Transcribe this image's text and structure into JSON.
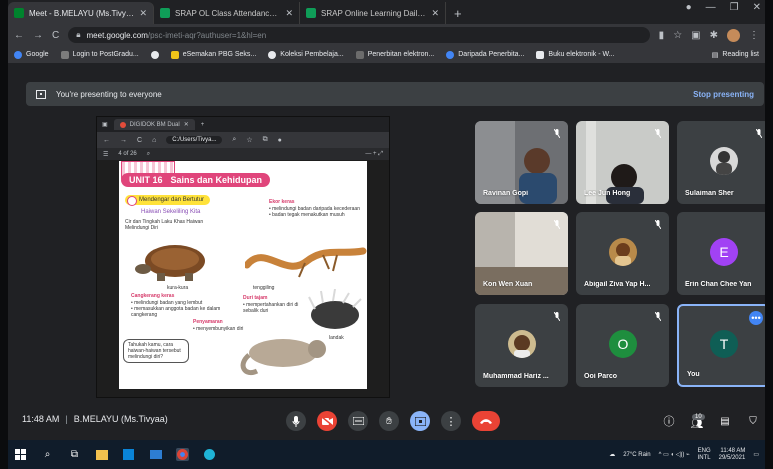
{
  "browser": {
    "tabs": [
      {
        "label": "Meet - B.MELAYU (Ms.Tivyaa)",
        "icon": "meet-icon",
        "active": true
      },
      {
        "label": "SRAP OL Class Attendance ( Mi",
        "icon": "sheets-icon",
        "active": false
      },
      {
        "label": "SRAP Online Learning Daily Rep",
        "icon": "sheets-icon",
        "active": false
      }
    ],
    "url_host": "meet.google.com",
    "url_path": "/psc-imeti-aqr?authuser=1&hl=en",
    "bookmarks": [
      {
        "label": "Google",
        "color": "#4285f4"
      },
      {
        "label": "Login to PostGradu...",
        "color": "#7c7c7c"
      },
      {
        "label": "",
        "color": "#e8eaed"
      },
      {
        "label": "eSemakan PBG Seks...",
        "color": "#f0c419"
      },
      {
        "label": "Koleksi Pembelaja...",
        "color": "#e8eaed"
      },
      {
        "label": "Penerbitan elektron...",
        "color": "#6c6c6c"
      },
      {
        "label": "Daripada Penerbita...",
        "color": "#4285f4"
      },
      {
        "label": "Buku elektronik - W...",
        "color": "#e8eaed"
      }
    ],
    "reading_list": "Reading list"
  },
  "meet": {
    "banner_text": "You're presenting to everyone",
    "stop_label": "Stop presenting",
    "time": "11:48 AM",
    "meeting_name": "B.MELAYU (Ms.Tivyaa)",
    "participant_count": "10",
    "participants": [
      {
        "name": "Ravinan Gopi",
        "kind": "video",
        "muted": true
      },
      {
        "name": "Lee Jun Hong",
        "kind": "video",
        "muted": true
      },
      {
        "name": "Sulaiman Sher",
        "kind": "photo",
        "muted": true
      },
      {
        "name": "Kon Wen Xuan",
        "kind": "video",
        "muted": true
      },
      {
        "name": "Abigail Ziva Yap H...",
        "kind": "photo",
        "muted": true
      },
      {
        "name": "Erin Chan Chee Yan",
        "kind": "letter",
        "letter": "E",
        "color": "#a142f4",
        "muted": false
      },
      {
        "name": "Muhammad Hariz ...",
        "kind": "photo",
        "muted": true
      },
      {
        "name": "Ooi Parco",
        "kind": "letter",
        "letter": "O",
        "color": "#1e8e3e",
        "muted": true
      },
      {
        "name": "You",
        "kind": "letter",
        "letter": "T",
        "color": "#0f5e55",
        "muted": false
      }
    ]
  },
  "presented": {
    "tab_label": "DIGIDOK BM Dual",
    "file_label": "C:/Users/Tivya...",
    "zoom": "4 of 26",
    "unit": "UNIT 16",
    "unit_title": "Sains dan Kehidupan",
    "subtitle": "Mendengar dan Bertutur",
    "topic": "Haiwan Sekeliling Kita",
    "intro": "Cir dan Tingkah Laku Khas Haiwan Melindungi Diri",
    "tortoise_label": "kura-kura",
    "tortoise_head": "Cangkerang keras",
    "tortoise_text": "• melindungi badan yang lembut\n• memasukkan anggota badan ke dalam cangkerang",
    "lizard_head": "Ekor keras",
    "lizard_text": "• melindungi badan daripada kecederaan\n• badan tegak menakutkan musuh",
    "lizard_label": "tenggiling",
    "porcupine_head": "Duri tajam",
    "porcupine_text": "• mempertahankan diri di sebalik duri",
    "porcupine_label": "landak",
    "chameleon_head": "Penyamaran",
    "chameleon_text": "• menyembunyikan diri",
    "callout": "Tahukah kamu, cara haiwan-haiwan tersebut melindungi diri?"
  },
  "taskbar": {
    "weather": "27°C Rain",
    "lang_top": "ENG",
    "lang_bottom": "INTL",
    "time": "11:48 AM",
    "date": "29/5/2021"
  }
}
